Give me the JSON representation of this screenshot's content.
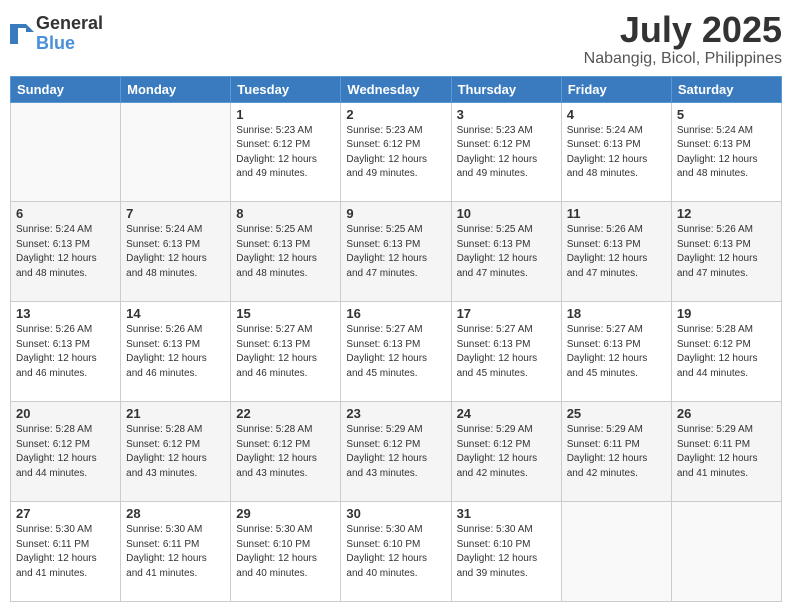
{
  "logo": {
    "general": "General",
    "blue": "Blue"
  },
  "header": {
    "title": "July 2025",
    "subtitle": "Nabangig, Bicol, Philippines"
  },
  "days": [
    "Sunday",
    "Monday",
    "Tuesday",
    "Wednesday",
    "Thursday",
    "Friday",
    "Saturday"
  ],
  "weeks": [
    [
      {
        "num": "",
        "content": ""
      },
      {
        "num": "",
        "content": ""
      },
      {
        "num": "1",
        "content": "Sunrise: 5:23 AM\nSunset: 6:12 PM\nDaylight: 12 hours\nand 49 minutes."
      },
      {
        "num": "2",
        "content": "Sunrise: 5:23 AM\nSunset: 6:12 PM\nDaylight: 12 hours\nand 49 minutes."
      },
      {
        "num": "3",
        "content": "Sunrise: 5:23 AM\nSunset: 6:12 PM\nDaylight: 12 hours\nand 49 minutes."
      },
      {
        "num": "4",
        "content": "Sunrise: 5:24 AM\nSunset: 6:13 PM\nDaylight: 12 hours\nand 48 minutes."
      },
      {
        "num": "5",
        "content": "Sunrise: 5:24 AM\nSunset: 6:13 PM\nDaylight: 12 hours\nand 48 minutes."
      }
    ],
    [
      {
        "num": "6",
        "content": "Sunrise: 5:24 AM\nSunset: 6:13 PM\nDaylight: 12 hours\nand 48 minutes."
      },
      {
        "num": "7",
        "content": "Sunrise: 5:24 AM\nSunset: 6:13 PM\nDaylight: 12 hours\nand 48 minutes."
      },
      {
        "num": "8",
        "content": "Sunrise: 5:25 AM\nSunset: 6:13 PM\nDaylight: 12 hours\nand 48 minutes."
      },
      {
        "num": "9",
        "content": "Sunrise: 5:25 AM\nSunset: 6:13 PM\nDaylight: 12 hours\nand 47 minutes."
      },
      {
        "num": "10",
        "content": "Sunrise: 5:25 AM\nSunset: 6:13 PM\nDaylight: 12 hours\nand 47 minutes."
      },
      {
        "num": "11",
        "content": "Sunrise: 5:26 AM\nSunset: 6:13 PM\nDaylight: 12 hours\nand 47 minutes."
      },
      {
        "num": "12",
        "content": "Sunrise: 5:26 AM\nSunset: 6:13 PM\nDaylight: 12 hours\nand 47 minutes."
      }
    ],
    [
      {
        "num": "13",
        "content": "Sunrise: 5:26 AM\nSunset: 6:13 PM\nDaylight: 12 hours\nand 46 minutes."
      },
      {
        "num": "14",
        "content": "Sunrise: 5:26 AM\nSunset: 6:13 PM\nDaylight: 12 hours\nand 46 minutes."
      },
      {
        "num": "15",
        "content": "Sunrise: 5:27 AM\nSunset: 6:13 PM\nDaylight: 12 hours\nand 46 minutes."
      },
      {
        "num": "16",
        "content": "Sunrise: 5:27 AM\nSunset: 6:13 PM\nDaylight: 12 hours\nand 45 minutes."
      },
      {
        "num": "17",
        "content": "Sunrise: 5:27 AM\nSunset: 6:13 PM\nDaylight: 12 hours\nand 45 minutes."
      },
      {
        "num": "18",
        "content": "Sunrise: 5:27 AM\nSunset: 6:13 PM\nDaylight: 12 hours\nand 45 minutes."
      },
      {
        "num": "19",
        "content": "Sunrise: 5:28 AM\nSunset: 6:12 PM\nDaylight: 12 hours\nand 44 minutes."
      }
    ],
    [
      {
        "num": "20",
        "content": "Sunrise: 5:28 AM\nSunset: 6:12 PM\nDaylight: 12 hours\nand 44 minutes."
      },
      {
        "num": "21",
        "content": "Sunrise: 5:28 AM\nSunset: 6:12 PM\nDaylight: 12 hours\nand 43 minutes."
      },
      {
        "num": "22",
        "content": "Sunrise: 5:28 AM\nSunset: 6:12 PM\nDaylight: 12 hours\nand 43 minutes."
      },
      {
        "num": "23",
        "content": "Sunrise: 5:29 AM\nSunset: 6:12 PM\nDaylight: 12 hours\nand 43 minutes."
      },
      {
        "num": "24",
        "content": "Sunrise: 5:29 AM\nSunset: 6:12 PM\nDaylight: 12 hours\nand 42 minutes."
      },
      {
        "num": "25",
        "content": "Sunrise: 5:29 AM\nSunset: 6:11 PM\nDaylight: 12 hours\nand 42 minutes."
      },
      {
        "num": "26",
        "content": "Sunrise: 5:29 AM\nSunset: 6:11 PM\nDaylight: 12 hours\nand 41 minutes."
      }
    ],
    [
      {
        "num": "27",
        "content": "Sunrise: 5:30 AM\nSunset: 6:11 PM\nDaylight: 12 hours\nand 41 minutes."
      },
      {
        "num": "28",
        "content": "Sunrise: 5:30 AM\nSunset: 6:11 PM\nDaylight: 12 hours\nand 41 minutes."
      },
      {
        "num": "29",
        "content": "Sunrise: 5:30 AM\nSunset: 6:10 PM\nDaylight: 12 hours\nand 40 minutes."
      },
      {
        "num": "30",
        "content": "Sunrise: 5:30 AM\nSunset: 6:10 PM\nDaylight: 12 hours\nand 40 minutes."
      },
      {
        "num": "31",
        "content": "Sunrise: 5:30 AM\nSunset: 6:10 PM\nDaylight: 12 hours\nand 39 minutes."
      },
      {
        "num": "",
        "content": ""
      },
      {
        "num": "",
        "content": ""
      }
    ]
  ]
}
